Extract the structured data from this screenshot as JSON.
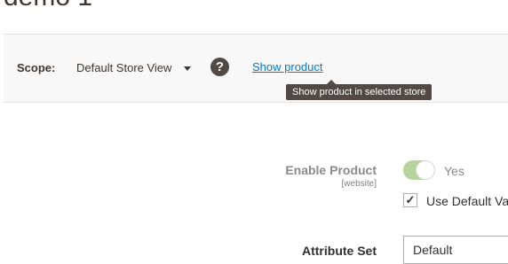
{
  "page": {
    "title": "demo 1"
  },
  "scope": {
    "label": "Scope:",
    "current": "Default Store View",
    "help_icon_glyph": "?",
    "show_product_link": "Show product",
    "tooltip": "Show product in selected store"
  },
  "form": {
    "enable_product": {
      "label": "Enable Product",
      "scope_note": "[website]",
      "value_label": "Yes",
      "enabled": true,
      "use_default_label": "Use Default Va",
      "use_default_checked": true
    },
    "attribute_set": {
      "label": "Attribute Set",
      "value": "Default"
    }
  },
  "colors": {
    "link": "#007bdb",
    "toggle_on": "#b5d49b",
    "tooltip_bg": "#514943"
  }
}
